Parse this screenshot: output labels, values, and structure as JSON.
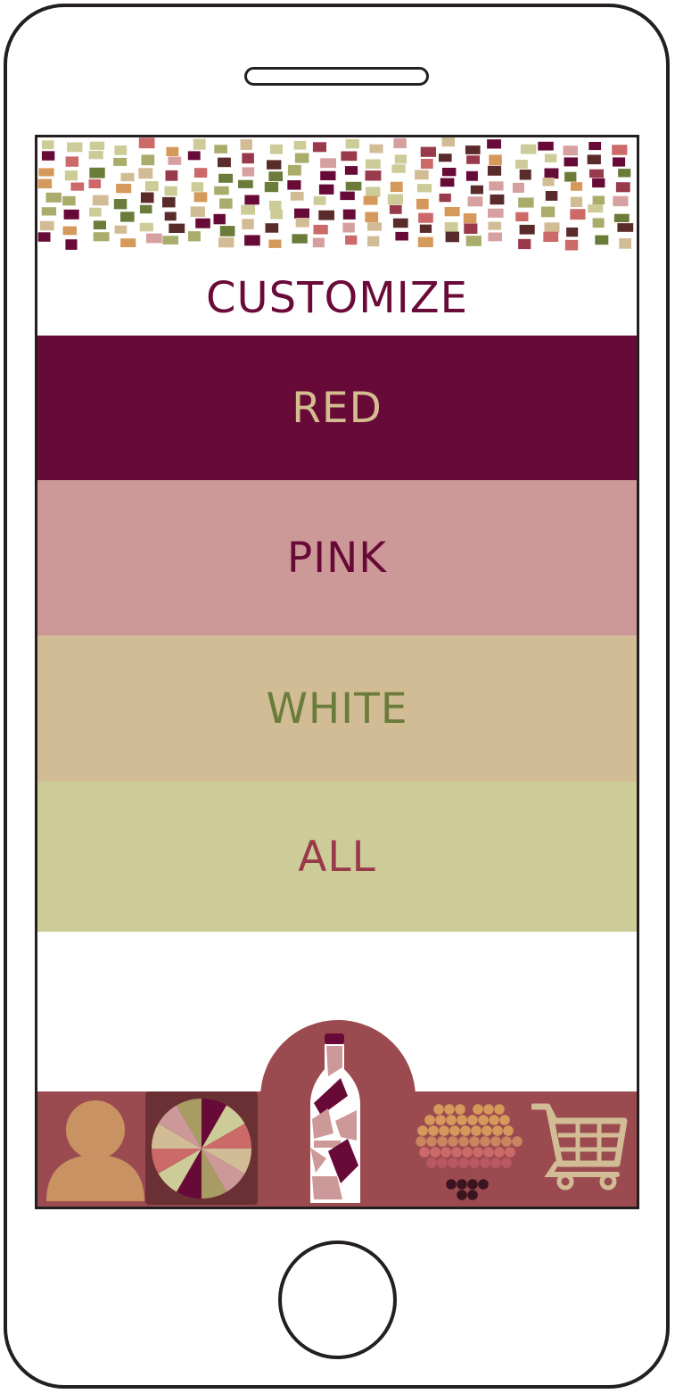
{
  "header": {
    "title": "CUSTOMIZE"
  },
  "menu": {
    "items": [
      {
        "label": "RED",
        "bg": "#680a37",
        "fg": "#d3bd8f"
      },
      {
        "label": "PINK",
        "bg": "#cc9898",
        "fg": "#680a37"
      },
      {
        "label": "WHITE",
        "bg": "#d2bc96",
        "fg": "#6b7c3a"
      },
      {
        "label": "ALL",
        "bg": "#cdcb97",
        "fg": "#993a4c"
      }
    ]
  },
  "tabbar": {
    "tabs": [
      {
        "icon": "profile-icon"
      },
      {
        "icon": "color-wheel-icon",
        "active": true
      },
      {
        "icon": "wine-bottle-icon"
      },
      {
        "icon": "grape-heart-icon"
      },
      {
        "icon": "shopping-cart-icon"
      }
    ]
  },
  "colors": {
    "wine": "#680a37",
    "rose": "#cc9898",
    "tan": "#d2bc96",
    "sage": "#cdcb97",
    "tabbar": "#9b4b50",
    "olive": "#6b7c3a"
  }
}
